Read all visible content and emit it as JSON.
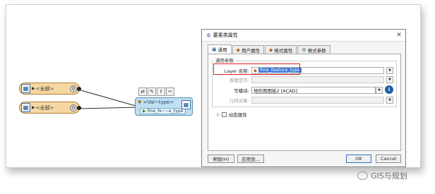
{
  "canvas": {
    "reader1": {
      "label": "<全部>"
    },
    "reader2": {
      "label": "<全部>"
    },
    "writer": {
      "feature_type": "<Val~type>",
      "attribute": "fme_fe~~e_type"
    },
    "toolbar_icons": [
      "link-icon",
      "edit-icon",
      "export-icon",
      "wrench-icon"
    ]
  },
  "dialog": {
    "title": "要素类属性",
    "tabs": [
      {
        "label": "通用",
        "active": true
      },
      {
        "label": "用户属性",
        "active": false
      },
      {
        "label": "格式属性",
        "active": false
      },
      {
        "label": "格式参数",
        "active": false
      }
    ],
    "group_label": "通用参数",
    "fields": {
      "layer_name": {
        "label": "Layer 名称:",
        "value": "fme_feature_type"
      },
      "table_qualifier": {
        "label": "表限定符:"
      },
      "writer_module": {
        "label": "写模块:",
        "value": "地形图图纸2 [ACAD]"
      },
      "geometry": {
        "label": "几何对象:"
      }
    },
    "dynamic_props": {
      "label": "动态属性"
    },
    "buttons": {
      "help": "帮助(H)",
      "apply_to": "应用到...",
      "ok": "OK",
      "cancel": "Cancel"
    }
  },
  "watermark": {
    "text": "GIS与规划"
  },
  "colors": {
    "reader_fill": "#f6d7a3",
    "writer_fill": "#bfe0f3",
    "highlight": "#e02020",
    "selection": "#3b79d8"
  }
}
